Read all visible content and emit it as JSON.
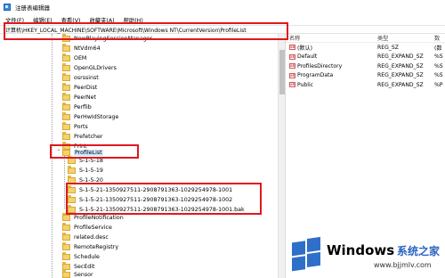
{
  "window": {
    "title": "注册表编辑器"
  },
  "menu": [
    "文件(F)",
    "编辑(E)",
    "查看(V)",
    "收藏夹(A)",
    "帮助(H)"
  ],
  "address": {
    "path": "计算机\\HKEY_LOCAL_MACHINE\\SOFTWARE\\Microsoft\\Windows NT\\CurrentVersion\\ProfileList"
  },
  "tree": {
    "nodes": [
      "NowPlayingSessionManager",
      "NtVdm64",
      "OEM",
      "OpenGLDrivers",
      "osrssinst",
      "PeerDist",
      "PeerNet",
      "Perflib",
      "PerHwIdStorage",
      "Ports",
      "Prefetcher",
      "Print",
      "ProfileList",
      "S-1-5-18",
      "S-1-5-19",
      "S-1-5-20",
      "S-1-5-21-1350927511-2908791363-1029254978-1001",
      "S-1-5-21-1350927511-2908791363-1029254978-1002",
      "S-1-5-21-1350927511-2908791363-1029254978-1001.bak",
      "ProfileNotification",
      "ProfileService",
      "related.desc",
      "RemoteRegistry",
      "Schedule",
      "SecEdit",
      "Sensor"
    ],
    "expanded_marker": "⌄",
    "collapsed_marker": "›"
  },
  "values": {
    "headers": {
      "name": "名称",
      "type": "类型",
      "data": "数"
    },
    "rows": [
      {
        "name": "(默认)",
        "type": "REG_SZ",
        "data": "(数"
      },
      {
        "name": "Default",
        "type": "REG_EXPAND_SZ",
        "data": "%S"
      },
      {
        "name": "ProfilesDirectory",
        "type": "REG_EXPAND_SZ",
        "data": "%S"
      },
      {
        "name": "ProgramData",
        "type": "REG_EXPAND_SZ",
        "data": "%S"
      },
      {
        "name": "Public",
        "type": "REG_EXPAND_SZ",
        "data": "%P"
      }
    ]
  },
  "watermark": {
    "brand": "Windows",
    "cn": "系统之家",
    "url": "www.bjjmlv.com"
  },
  "colors": {
    "highlight": "#e0181d",
    "selection": "#cce8ff",
    "folder": "#f3d36b"
  }
}
